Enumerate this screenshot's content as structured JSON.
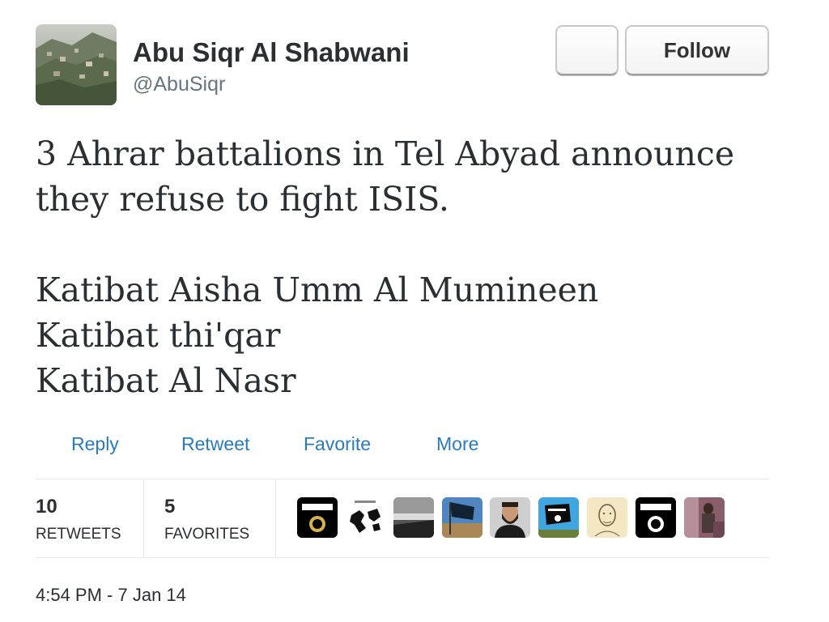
{
  "author": {
    "display_name": "Abu Siqr Al Shabwani",
    "handle": "@AbuSiqr"
  },
  "header": {
    "follow_label": "Follow",
    "user_actions_icon": "user-actions-icon"
  },
  "tweet": {
    "lines": [
      "3 Ahrar battalions in Tel Abyad announce",
      "they refuse to fight ISIS.",
      "",
      "Katibat Aisha Umm Al Mumineen",
      "Katibat thi'qar",
      "Katibat Al Nasr"
    ]
  },
  "actions": {
    "reply": "Reply",
    "retweet": "Retweet",
    "favorite": "Favorite",
    "more": "More"
  },
  "stats": {
    "retweets_count": "10",
    "retweets_label": "RETWEETS",
    "favorites_count": "5",
    "favorites_label": "FAVORITES"
  },
  "engagers": [
    "black-flag-avatar",
    "world-map-avatar",
    "sea-landscape-avatar",
    "flag-sky-avatar",
    "bearded-man-avatar",
    "flag-blue-sky-avatar",
    "sketch-face-avatar",
    "black-flag-avatar",
    "person-room-avatar"
  ],
  "timestamp": "4:54 PM - 7 Jan 14",
  "colors": {
    "link": "#2b7bb9",
    "text": "#292f33",
    "muted": "#66757f",
    "divider": "#e1e8ed"
  }
}
